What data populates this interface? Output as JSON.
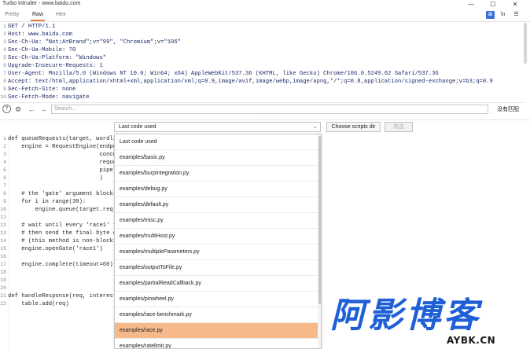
{
  "window": {
    "title": "Turbo Intruder - www.baidu.com",
    "controls": [
      "—",
      "☐",
      "✕"
    ]
  },
  "tabs": [
    {
      "label": "Pretty",
      "active": false
    },
    {
      "label": "Raw",
      "active": true
    },
    {
      "label": "Hex",
      "active": false
    }
  ],
  "tab_icons": [
    "≣",
    "\\n",
    "☰"
  ],
  "request": {
    "lines": [
      {
        "n": "1",
        "text": "GET / HTTP/1.1"
      },
      {
        "n": "2",
        "text": "Host: www.baidu.com"
      },
      {
        "n": "3",
        "text": "Sec-Ch-Ua: \"Not;A=Brand\";v=\"99\", \"Chromium\";v=\"106\""
      },
      {
        "n": "4",
        "text": "Sec-Ch-Ua-Mobile: ?0"
      },
      {
        "n": "5",
        "text": "Sec-Ch-Ua-Platform: \"Windows\""
      },
      {
        "n": "6",
        "text": "Upgrade-Insecure-Requests: 1"
      },
      {
        "n": "7",
        "text": "User-Agent: Mozilla/5.0 (Windows NT 10.0; Win64; x64) AppleWebKit/537.36 (KHTML, like Gecko) Chrome/106.0.5249.62 Safari/537.36"
      },
      {
        "n": "8",
        "text": "Accept: text/html,application/xhtml+xml,application/xml;q=0.9,image/avif,image/webp,image/apng,*/*;q=0.8,application/signed-exchange;v=b3;q=0.9"
      },
      {
        "n": "9",
        "text": "Sec-Fetch-Site: none"
      },
      {
        "n": "10",
        "text": "Sec-Fetch-Mode: navigate"
      }
    ]
  },
  "search": {
    "placeholder": "Search...",
    "result": "没有匹配",
    "icons": [
      "?",
      "⚙",
      "←",
      "→"
    ]
  },
  "toolbar": {
    "script_select": "Last code used",
    "choose_label": "Choose scripts dir",
    "attack_label": "攻击"
  },
  "script": {
    "lines": [
      {
        "n": "1",
        "text": "def queueRequests(target, wordli"
      },
      {
        "n": "2",
        "text": "    engine = RequestEngine(endpo"
      },
      {
        "n": "3",
        "text": "                           concu"
      },
      {
        "n": "4",
        "text": "                           reque"
      },
      {
        "n": "5",
        "text": "                           pipel"
      },
      {
        "n": "6",
        "text": "                           )"
      },
      {
        "n": "7",
        "text": ""
      },
      {
        "n": "8",
        "text": "    # the 'gate' argument blocki"
      },
      {
        "n": "9",
        "text": "    for i in range(30):"
      },
      {
        "n": "10",
        "text": "        engine.queue(target.req,"
      },
      {
        "n": "11",
        "text": ""
      },
      {
        "n": "12",
        "text": "    # wait until every 'race1' t"
      },
      {
        "n": "13",
        "text": "    # then send the final byte o"
      },
      {
        "n": "14",
        "text": "    # (this method is non-blocki"
      },
      {
        "n": "15",
        "text": "    engine.openGate('race1')"
      },
      {
        "n": "16",
        "text": ""
      },
      {
        "n": "17",
        "text": "    engine.complete(timeout=60)"
      },
      {
        "n": "18",
        "text": ""
      },
      {
        "n": "19",
        "text": ""
      },
      {
        "n": "20",
        "text": ""
      },
      {
        "n": "21",
        "text": "def handleResponse(req, interest"
      },
      {
        "n": "22",
        "text": "    table.add(req)"
      }
    ]
  },
  "dropdown": {
    "items": [
      {
        "label": "Last code used",
        "selected": false
      },
      {
        "label": "examples/basic.py",
        "selected": false
      },
      {
        "label": "examples/burpIntegration.py",
        "selected": false
      },
      {
        "label": "examples/debug.py",
        "selected": false
      },
      {
        "label": "examples/default.py",
        "selected": false
      },
      {
        "label": "examples/misc.py",
        "selected": false
      },
      {
        "label": "examples/multiHost.py",
        "selected": false
      },
      {
        "label": "examples/multipleParameters.py",
        "selected": false
      },
      {
        "label": "examples/outputToFile.py",
        "selected": false
      },
      {
        "label": "examples/partialReadCallback.py",
        "selected": false
      },
      {
        "label": "examples/pinwheel.py",
        "selected": false
      },
      {
        "label": "examples/race-benchmark.py",
        "selected": false
      },
      {
        "label": "examples/race.py",
        "selected": true
      },
      {
        "label": "examples/ratelimit.py",
        "selected": false
      }
    ]
  },
  "watermark": {
    "text": "阿影博客",
    "sub": "AYBK.CN"
  },
  "colors": {
    "accent_tab": "#e8823a",
    "selected_item": "#f6b98a",
    "watermark": "#1f5fd6"
  }
}
